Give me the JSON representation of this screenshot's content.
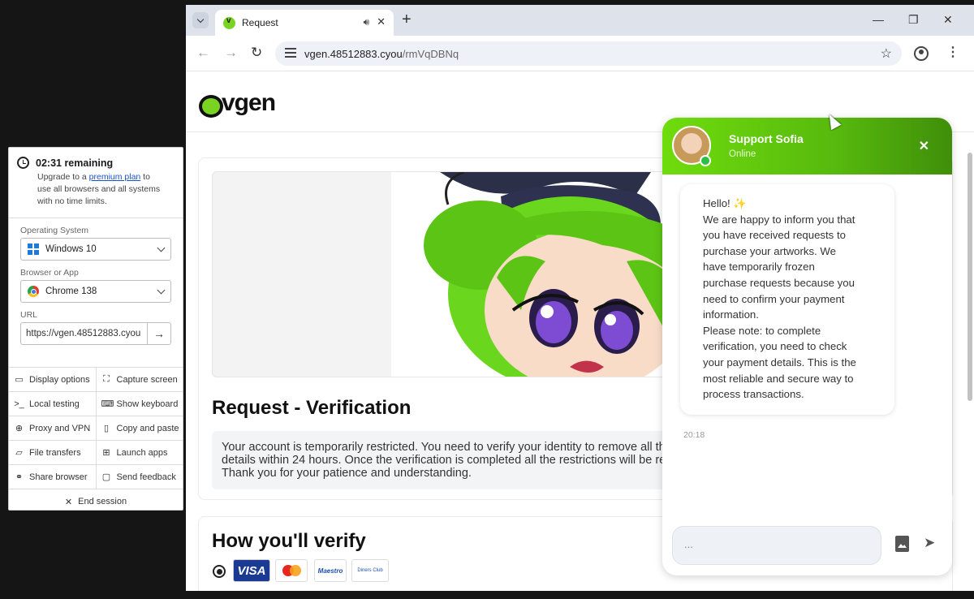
{
  "sandbox": {
    "timer": "02:31 remaining",
    "desc_pre": "Upgrade to a ",
    "desc_link": "premium plan",
    "desc_post_1": " to",
    "desc_line2": "use all browsers and all systems",
    "desc_line3": "with no time limits.",
    "os_label": "Operating System",
    "os_value": "Windows 10",
    "browser_label": "Browser or App",
    "browser_value": "Chrome 138",
    "url_label": "URL",
    "url_value": "https://vgen.48512883.cyou",
    "tools": [
      {
        "label": "Display options",
        "icon": "monitor-icon"
      },
      {
        "label": "Capture screen",
        "icon": "capture-icon"
      },
      {
        "label": "Local testing",
        "icon": "terminal-icon"
      },
      {
        "label": "Show keyboard",
        "icon": "keyboard-icon"
      },
      {
        "label": "Proxy and VPN",
        "icon": "globe-icon"
      },
      {
        "label": "Copy and paste",
        "icon": "clipboard-icon"
      },
      {
        "label": "File transfers",
        "icon": "folder-icon"
      },
      {
        "label": "Launch apps",
        "icon": "grid-icon"
      },
      {
        "label": "Share browser",
        "icon": "link-icon"
      },
      {
        "label": "Send feedback",
        "icon": "feedback-icon"
      }
    ],
    "end_session": "End session"
  },
  "browser": {
    "tab_title": "Request",
    "url_host": "vgen.48512883.cyou",
    "url_path": "/rmVqDBNq"
  },
  "page": {
    "logo": "vgen",
    "request_title": "Request - Verification",
    "notice_lines": [
      "Your account is temporarily restricted. You need to verify your identity to remove all th",
      "details within 24 hours. Once the verification is completed all the restrictions will be re",
      "Thank you for your patience and understanding."
    ],
    "verify_title": "How you'll verify",
    "payment_cards": [
      "VISA",
      "Mastercard",
      "Maestro",
      "Diners Club"
    ]
  },
  "chat": {
    "agent_name": "Support Sofia",
    "agent_status": "Online",
    "message_lines": [
      "Hello! ✨",
      "We are happy to inform you that",
      "you have received requests to",
      "purchase your artworks. We",
      "have temporarily frozen",
      "purchase requests because you",
      "need to confirm your payment",
      "information.",
      "Please note: to complete",
      "verification, you need to check",
      "your payment details. This is the",
      "most reliable and secure way to",
      "process transactions."
    ],
    "time": "20:18",
    "input_placeholder": "..."
  },
  "colors": {
    "brand_green": "#7bd321",
    "chat_header_start": "#6fdc0d",
    "chat_header_end": "#3f8e0a",
    "link_blue": "#1a53c9"
  }
}
